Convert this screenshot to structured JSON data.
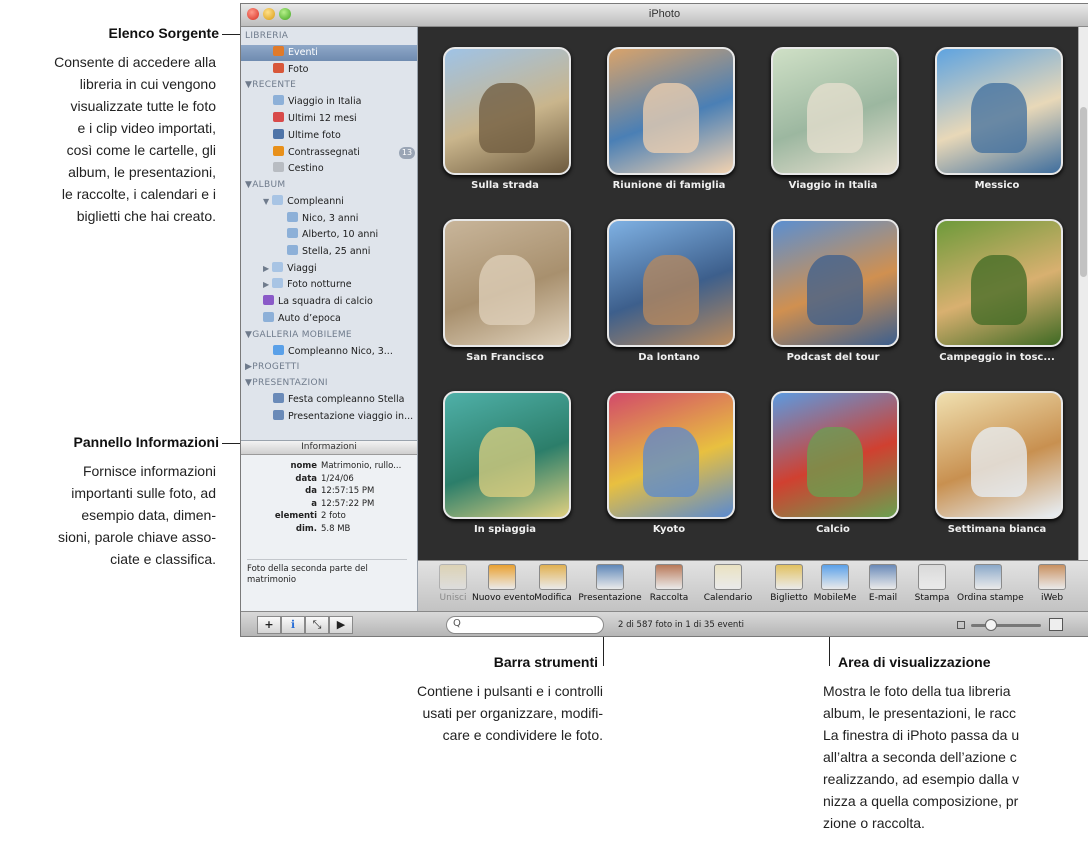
{
  "annotations": {
    "source_list": {
      "title": "Elenco Sorgente",
      "lines": [
        "Consente di accedere alla",
        "libreria in cui vengono",
        "visualizzate tutte le foto",
        "e i clip video importati,",
        "così come le cartelle, gli",
        "album, le presentazioni,",
        "le raccolte, i calendari e i",
        "biglietti che hai creato."
      ]
    },
    "info_panel": {
      "title": "Pannello Informazioni",
      "lines": [
        "Fornisce informazioni",
        "importanti sulle foto, ad",
        "esempio data, dimen-",
        "sioni, parole chiave asso-",
        "ciate e classifica."
      ]
    },
    "toolbar": {
      "title": "Barra strumenti",
      "lines": [
        "Contiene i pulsanti e i controlli",
        "usati per organizzare, modifi-",
        "care e condividere le foto."
      ]
    },
    "viewing_area": {
      "title": "Area di visualizzazione",
      "lines": [
        "Mostra le foto della tua libreria",
        "album, le presentazioni, le racc",
        "La finestra di iPhoto passa da u",
        "all’altra a seconda dell’azione c",
        "realizzando, ad esempio dalla v",
        "nizza a quella composizione, pr",
        "zione o raccolta."
      ]
    }
  },
  "window": {
    "title": "iPhoto"
  },
  "sidebar": {
    "library_header": "LIBRERIA",
    "library": [
      {
        "label": "Eventi",
        "icon": "events-icon",
        "selected": true
      },
      {
        "label": "Foto",
        "icon": "photos-icon"
      }
    ],
    "recent_header": "▼RECENTE",
    "recent": [
      {
        "label": "Viaggio in Italia",
        "icon": "album-icon"
      },
      {
        "label": "Ultimi 12 mesi",
        "icon": "calendar-icon"
      },
      {
        "label": "Ultime foto",
        "icon": "import-icon"
      },
      {
        "label": "Contrassegnati",
        "icon": "flag-icon",
        "badge": "13"
      },
      {
        "label": "Cestino",
        "icon": "trash-icon"
      }
    ],
    "album_header": "▼ALBUM",
    "albums": [
      {
        "label": "Compleanni",
        "icon": "folder-icon",
        "indent": 1,
        "tri": "▼"
      },
      {
        "label": "Nico, 3 anni",
        "icon": "album-icon",
        "indent": 2
      },
      {
        "label": "Alberto, 10 anni",
        "icon": "album-icon",
        "indent": 2
      },
      {
        "label": "Stella, 25 anni",
        "icon": "album-icon",
        "indent": 2
      },
      {
        "label": "Viaggi",
        "icon": "folder-icon",
        "indent": 1,
        "tri": "▶"
      },
      {
        "label": "Foto notturne",
        "icon": "folder-icon",
        "indent": 1,
        "tri": "▶"
      },
      {
        "label": "La squadra di calcio",
        "icon": "smart-album-icon",
        "indent": 1
      },
      {
        "label": "Auto d’epoca",
        "icon": "album-icon",
        "indent": 1
      }
    ],
    "gallery_header": "▼GALLERIA MOBILEME",
    "gallery": [
      {
        "label": "Compleanno Nico, 3...",
        "icon": "mobileme-album-icon"
      }
    ],
    "projects_header": "▶PROGETTI",
    "slideshows_header": "▼PRESENTAZIONI",
    "slideshows": [
      {
        "label": "Festa compleanno Stella",
        "icon": "slideshow-icon"
      },
      {
        "label": "Presentazione viaggio in...",
        "icon": "slideshow-icon"
      }
    ]
  },
  "info": {
    "header": "Informazioni",
    "rows": [
      {
        "key": "nome",
        "value": "Matrimonio, rullo..."
      },
      {
        "key": "data",
        "value": "1/24/06"
      },
      {
        "key": "da",
        "value": "12:57:15 PM"
      },
      {
        "key": "a",
        "value": "12:57:22 PM"
      },
      {
        "key": "elementi",
        "value": "2 foto"
      },
      {
        "key": "dim.",
        "value": "5.8 MB"
      }
    ],
    "description": "Foto della seconda parte del matrimonio"
  },
  "events": [
    {
      "label": "Sulla strada",
      "colors": [
        "#9fc3e6",
        "#c9b58c",
        "#6d5a3e"
      ]
    },
    {
      "label": "Riunione di famiglia",
      "colors": [
        "#d9a36a",
        "#4a7fb5",
        "#f2d2b0"
      ]
    },
    {
      "label": "Viaggio in Italia",
      "colors": [
        "#cfe0c6",
        "#9cb7a0",
        "#e8e0d0"
      ]
    },
    {
      "label": "Messico",
      "colors": [
        "#5ea3e0",
        "#e8d8b8",
        "#3f6e9e"
      ]
    },
    {
      "label": "San Francisco",
      "colors": [
        "#c8b59a",
        "#a8906e",
        "#e0d2bc"
      ]
    },
    {
      "label": "Da lontano",
      "colors": [
        "#7fb1e3",
        "#3d5f8c",
        "#b98a5c"
      ]
    },
    {
      "label": "Podcast del tour",
      "colors": [
        "#5b8fd0",
        "#d09050",
        "#3c5f8e"
      ]
    },
    {
      "label": "Campeggio in tosc...",
      "colors": [
        "#6d9a3a",
        "#d8b070",
        "#3f6a24"
      ]
    },
    {
      "label": "In spiaggia",
      "colors": [
        "#4fb0a8",
        "#2c7e6a",
        "#e0d080"
      ]
    },
    {
      "label": "Kyoto",
      "colors": [
        "#d24a6a",
        "#e8c040",
        "#5a8ad0"
      ]
    },
    {
      "label": "Calcio",
      "colors": [
        "#5c9ae0",
        "#d04030",
        "#6aa050"
      ]
    },
    {
      "label": "Settimana bianca",
      "colors": [
        "#f0e0b0",
        "#c89050",
        "#e8f0f8"
      ]
    }
  ],
  "toolbar": [
    {
      "label": "Unisci",
      "icon": "merge-icon",
      "disabled": true,
      "color": "#d8c48a"
    },
    {
      "label": "Nuovo evento",
      "icon": "new-event-icon",
      "color": "#e8a030"
    },
    {
      "label": "Modifica",
      "icon": "pencil-icon",
      "color": "#e0b050"
    },
    {
      "label": "Presentazione",
      "icon": "slideshow-icon",
      "color": "#5f87b8"
    },
    {
      "label": "Raccolta",
      "icon": "book-icon",
      "color": "#b87858"
    },
    {
      "label": "Calendario",
      "icon": "calendar-icon",
      "color": "#e8e0c0"
    },
    {
      "label": "Biglietto",
      "icon": "card-icon",
      "color": "#e0c060"
    },
    {
      "label": "MobileMe",
      "icon": "mobileme-icon",
      "color": "#5aa0e8"
    },
    {
      "label": "E-mail",
      "icon": "email-icon",
      "color": "#6a8ab8"
    },
    {
      "label": "Stampa",
      "icon": "print-icon",
      "color": "#d8d8d8"
    },
    {
      "label": "Ordina stampe",
      "icon": "order-prints-icon",
      "color": "#8aa8c8"
    },
    {
      "label": "iWeb",
      "icon": "iweb-icon",
      "color": "#c89060"
    }
  ],
  "bottombar": {
    "buttons": [
      "+",
      "ℹ",
      "⤡",
      "▶"
    ],
    "search_placeholder": "Q",
    "status": "2 di 587 foto in 1 di 35 eventi"
  }
}
